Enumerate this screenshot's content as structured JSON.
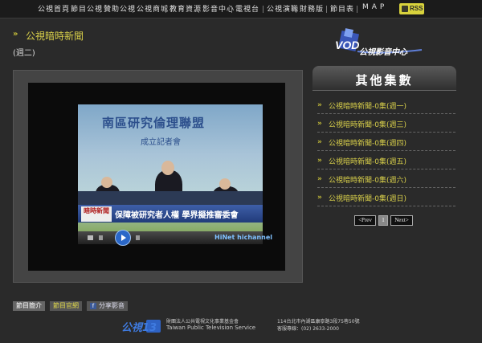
{
  "nav": {
    "items": [
      "公視首頁",
      "節目公視",
      "贊助公視",
      "公視商城",
      "教育資源",
      "影音中心",
      "電視台",
      "公視演職",
      "財務版",
      "節目表",
      "MAP"
    ],
    "rss": "RSS"
  },
  "page": {
    "title": "公視暗時新聞",
    "subtitle": "(週二)"
  },
  "logo": {
    "text": "公視影音中心"
  },
  "video": {
    "banner_title": "南區研究倫理聯盟",
    "banner_sub": "成立記者會",
    "caption_tag": "暗時新聞",
    "caption_text": "保障被研究者人權 學界擬推審委會",
    "watermark": "HiNet hichannel"
  },
  "sidebar": {
    "header": "其他集數",
    "episodes": [
      "公視暗時新聞-0集(週一)",
      "公視暗時新聞-0集(週三)",
      "公視暗時新聞-0集(週四)",
      "公視暗時新聞-0集(週五)",
      "公視暗時新聞-0集(週六)",
      "公視暗時新聞-0集(週日)"
    ],
    "pager": {
      "prev": "<Prev",
      "page": "1",
      "next": "Next>"
    }
  },
  "buttons": {
    "intro": "節目簡介",
    "site": "節目官網",
    "share": "分享影音"
  },
  "footer": {
    "logo": "公視13",
    "org": "財團法人公共電視文化事業基金會",
    "org_en": "Taiwan Public Television Service",
    "address": "114台北市內湖區康寧路3段75巷50號",
    "tel": "客服專線：(02) 2633-2000"
  },
  "colors": {
    "accent": "#d8cf4a",
    "background": "#2a2a2a"
  }
}
